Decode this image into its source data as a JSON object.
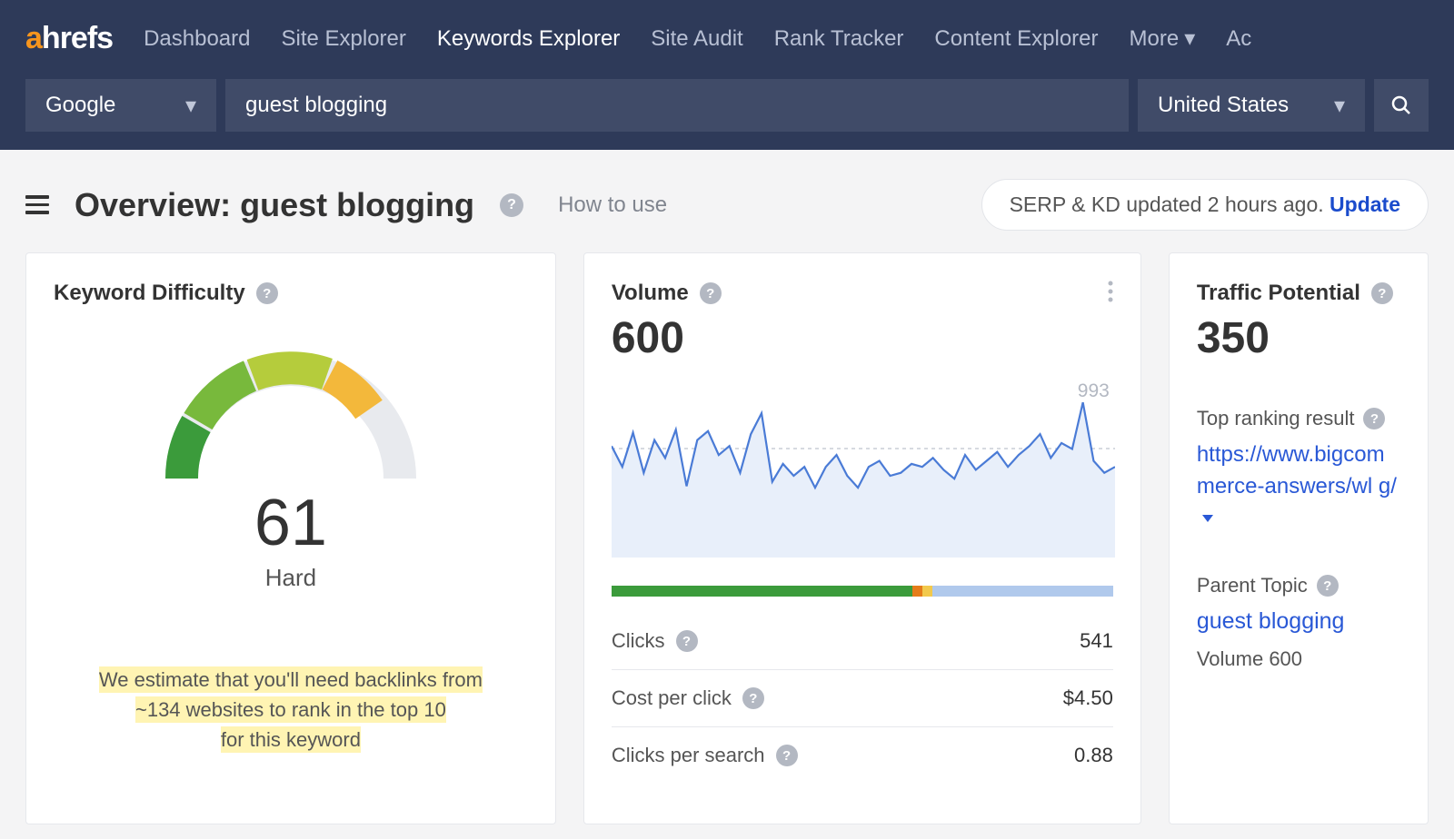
{
  "brand": {
    "a": "a",
    "rest": "hrefs"
  },
  "nav": {
    "items": [
      "Dashboard",
      "Site Explorer",
      "Keywords Explorer",
      "Site Audit",
      "Rank Tracker",
      "Content Explorer",
      "More",
      "Ac"
    ],
    "active_index": 2
  },
  "search": {
    "engine": "Google",
    "keyword": "guest blogging",
    "country": "United States"
  },
  "overview": {
    "title": "Overview: guest blogging",
    "how_to": "How to use",
    "updated_text": "SERP & KD updated 2 hours ago. ",
    "update_cta": "Update"
  },
  "kd": {
    "title": "Keyword Difficulty",
    "score": "61",
    "label": "Hard",
    "estimate_l1": "We estimate that you'll need backlinks from",
    "estimate_l2": "~134 websites to rank in the top 10",
    "estimate_l3": "for this keyword"
  },
  "volume": {
    "title": "Volume",
    "value": "600",
    "peak": "993",
    "meter": {
      "green": 0.6,
      "orange": 0.02,
      "yellow": 0.02,
      "blue": 0.36
    },
    "clicks_label": "Clicks",
    "clicks": "541",
    "cpc_label": "Cost per click",
    "cpc": "$4.50",
    "cps_label": "Clicks per search",
    "cps": "0.88"
  },
  "tp": {
    "title": "Traffic Potential",
    "value": "350",
    "top_label": "Top ranking result",
    "top_url": "https://www.bigcommerce-answers/what-is-guest-blogging/",
    "top_url_visible": "https://www.bigcommerce-answers/wl g/",
    "parent_label": "Parent Topic",
    "parent_topic": "guest blogging",
    "parent_volume": "Volume 600"
  },
  "chart_data": {
    "type": "line",
    "title": "Search volume trend",
    "ylim": [
      0,
      1000
    ],
    "avg": 600,
    "values": [
      700,
      560,
      790,
      520,
      740,
      620,
      810,
      430,
      740,
      800,
      640,
      700,
      520,
      780,
      920,
      460,
      580,
      500,
      560,
      420,
      560,
      640,
      500,
      420,
      560,
      600,
      500,
      520,
      580,
      560,
      620,
      540,
      480,
      640,
      540,
      600,
      660,
      560,
      640,
      700,
      780,
      620,
      720,
      680,
      993,
      600,
      520,
      560
    ],
    "xlabel": "",
    "ylabel": "Volume"
  }
}
